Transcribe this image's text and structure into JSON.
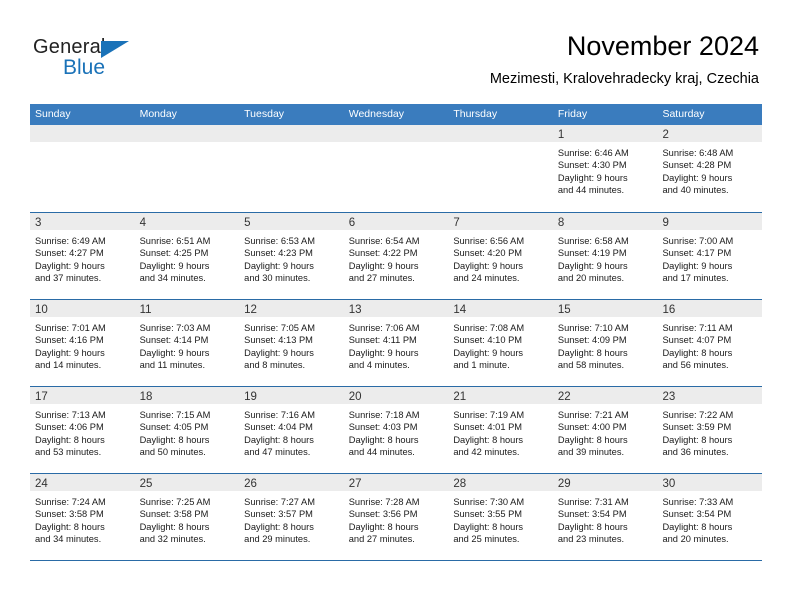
{
  "brand": {
    "name_part1": "General",
    "name_part2": "Blue",
    "triangle_icon": "triangle-icon",
    "accent_color": "#1a72b8"
  },
  "header": {
    "title": "November 2024",
    "subtitle": "Mezimesti, Kralovehradecky kraj, Czechia"
  },
  "theme": {
    "header_blue": "#3a7cbe",
    "rule_blue": "#2a6ba6",
    "day_band_gray": "#ececec"
  },
  "weekdays": [
    "Sunday",
    "Monday",
    "Tuesday",
    "Wednesday",
    "Thursday",
    "Friday",
    "Saturday"
  ],
  "weeks": [
    [
      {
        "day": "",
        "lines": []
      },
      {
        "day": "",
        "lines": []
      },
      {
        "day": "",
        "lines": []
      },
      {
        "day": "",
        "lines": []
      },
      {
        "day": "",
        "lines": []
      },
      {
        "day": "1",
        "lines": [
          "Sunrise: 6:46 AM",
          "Sunset: 4:30 PM",
          "Daylight: 9 hours",
          "and 44 minutes."
        ]
      },
      {
        "day": "2",
        "lines": [
          "Sunrise: 6:48 AM",
          "Sunset: 4:28 PM",
          "Daylight: 9 hours",
          "and 40 minutes."
        ]
      }
    ],
    [
      {
        "day": "3",
        "lines": [
          "Sunrise: 6:49 AM",
          "Sunset: 4:27 PM",
          "Daylight: 9 hours",
          "and 37 minutes."
        ]
      },
      {
        "day": "4",
        "lines": [
          "Sunrise: 6:51 AM",
          "Sunset: 4:25 PM",
          "Daylight: 9 hours",
          "and 34 minutes."
        ]
      },
      {
        "day": "5",
        "lines": [
          "Sunrise: 6:53 AM",
          "Sunset: 4:23 PM",
          "Daylight: 9 hours",
          "and 30 minutes."
        ]
      },
      {
        "day": "6",
        "lines": [
          "Sunrise: 6:54 AM",
          "Sunset: 4:22 PM",
          "Daylight: 9 hours",
          "and 27 minutes."
        ]
      },
      {
        "day": "7",
        "lines": [
          "Sunrise: 6:56 AM",
          "Sunset: 4:20 PM",
          "Daylight: 9 hours",
          "and 24 minutes."
        ]
      },
      {
        "day": "8",
        "lines": [
          "Sunrise: 6:58 AM",
          "Sunset: 4:19 PM",
          "Daylight: 9 hours",
          "and 20 minutes."
        ]
      },
      {
        "day": "9",
        "lines": [
          "Sunrise: 7:00 AM",
          "Sunset: 4:17 PM",
          "Daylight: 9 hours",
          "and 17 minutes."
        ]
      }
    ],
    [
      {
        "day": "10",
        "lines": [
          "Sunrise: 7:01 AM",
          "Sunset: 4:16 PM",
          "Daylight: 9 hours",
          "and 14 minutes."
        ]
      },
      {
        "day": "11",
        "lines": [
          "Sunrise: 7:03 AM",
          "Sunset: 4:14 PM",
          "Daylight: 9 hours",
          "and 11 minutes."
        ]
      },
      {
        "day": "12",
        "lines": [
          "Sunrise: 7:05 AM",
          "Sunset: 4:13 PM",
          "Daylight: 9 hours",
          "and 8 minutes."
        ]
      },
      {
        "day": "13",
        "lines": [
          "Sunrise: 7:06 AM",
          "Sunset: 4:11 PM",
          "Daylight: 9 hours",
          "and 4 minutes."
        ]
      },
      {
        "day": "14",
        "lines": [
          "Sunrise: 7:08 AM",
          "Sunset: 4:10 PM",
          "Daylight: 9 hours",
          "and 1 minute."
        ]
      },
      {
        "day": "15",
        "lines": [
          "Sunrise: 7:10 AM",
          "Sunset: 4:09 PM",
          "Daylight: 8 hours",
          "and 58 minutes."
        ]
      },
      {
        "day": "16",
        "lines": [
          "Sunrise: 7:11 AM",
          "Sunset: 4:07 PM",
          "Daylight: 8 hours",
          "and 56 minutes."
        ]
      }
    ],
    [
      {
        "day": "17",
        "lines": [
          "Sunrise: 7:13 AM",
          "Sunset: 4:06 PM",
          "Daylight: 8 hours",
          "and 53 minutes."
        ]
      },
      {
        "day": "18",
        "lines": [
          "Sunrise: 7:15 AM",
          "Sunset: 4:05 PM",
          "Daylight: 8 hours",
          "and 50 minutes."
        ]
      },
      {
        "day": "19",
        "lines": [
          "Sunrise: 7:16 AM",
          "Sunset: 4:04 PM",
          "Daylight: 8 hours",
          "and 47 minutes."
        ]
      },
      {
        "day": "20",
        "lines": [
          "Sunrise: 7:18 AM",
          "Sunset: 4:03 PM",
          "Daylight: 8 hours",
          "and 44 minutes."
        ]
      },
      {
        "day": "21",
        "lines": [
          "Sunrise: 7:19 AM",
          "Sunset: 4:01 PM",
          "Daylight: 8 hours",
          "and 42 minutes."
        ]
      },
      {
        "day": "22",
        "lines": [
          "Sunrise: 7:21 AM",
          "Sunset: 4:00 PM",
          "Daylight: 8 hours",
          "and 39 minutes."
        ]
      },
      {
        "day": "23",
        "lines": [
          "Sunrise: 7:22 AM",
          "Sunset: 3:59 PM",
          "Daylight: 8 hours",
          "and 36 minutes."
        ]
      }
    ],
    [
      {
        "day": "24",
        "lines": [
          "Sunrise: 7:24 AM",
          "Sunset: 3:58 PM",
          "Daylight: 8 hours",
          "and 34 minutes."
        ]
      },
      {
        "day": "25",
        "lines": [
          "Sunrise: 7:25 AM",
          "Sunset: 3:58 PM",
          "Daylight: 8 hours",
          "and 32 minutes."
        ]
      },
      {
        "day": "26",
        "lines": [
          "Sunrise: 7:27 AM",
          "Sunset: 3:57 PM",
          "Daylight: 8 hours",
          "and 29 minutes."
        ]
      },
      {
        "day": "27",
        "lines": [
          "Sunrise: 7:28 AM",
          "Sunset: 3:56 PM",
          "Daylight: 8 hours",
          "and 27 minutes."
        ]
      },
      {
        "day": "28",
        "lines": [
          "Sunrise: 7:30 AM",
          "Sunset: 3:55 PM",
          "Daylight: 8 hours",
          "and 25 minutes."
        ]
      },
      {
        "day": "29",
        "lines": [
          "Sunrise: 7:31 AM",
          "Sunset: 3:54 PM",
          "Daylight: 8 hours",
          "and 23 minutes."
        ]
      },
      {
        "day": "30",
        "lines": [
          "Sunrise: 7:33 AM",
          "Sunset: 3:54 PM",
          "Daylight: 8 hours",
          "and 20 minutes."
        ]
      }
    ]
  ]
}
